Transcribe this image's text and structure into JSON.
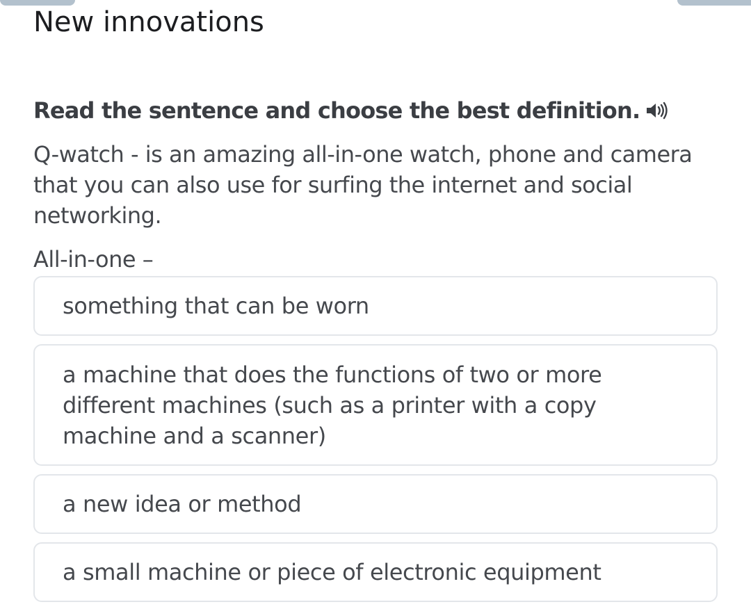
{
  "page": {
    "title": "New innovations"
  },
  "question": {
    "instruction": "Read the sentence and choose the best definition.",
    "audio_icon": "speaker-icon",
    "sentence": "Q-watch - is an amazing all-in-one watch, phone and camera that you can also use for surfing the internet and social networking.",
    "term": "All-in-one –"
  },
  "options": [
    {
      "label": "something that can be worn"
    },
    {
      "label": "a machine that does the functions of two or more different machines (such as a printer with a copy machine and a scanner)"
    },
    {
      "label": "a new idea or method"
    },
    {
      "label": "a small machine or piece of electronic equipment"
    }
  ],
  "colors": {
    "text": "#45484d",
    "title": "#1c1d20",
    "option_border": "#e3e6ea",
    "top_tab": "#b3c1cd"
  }
}
